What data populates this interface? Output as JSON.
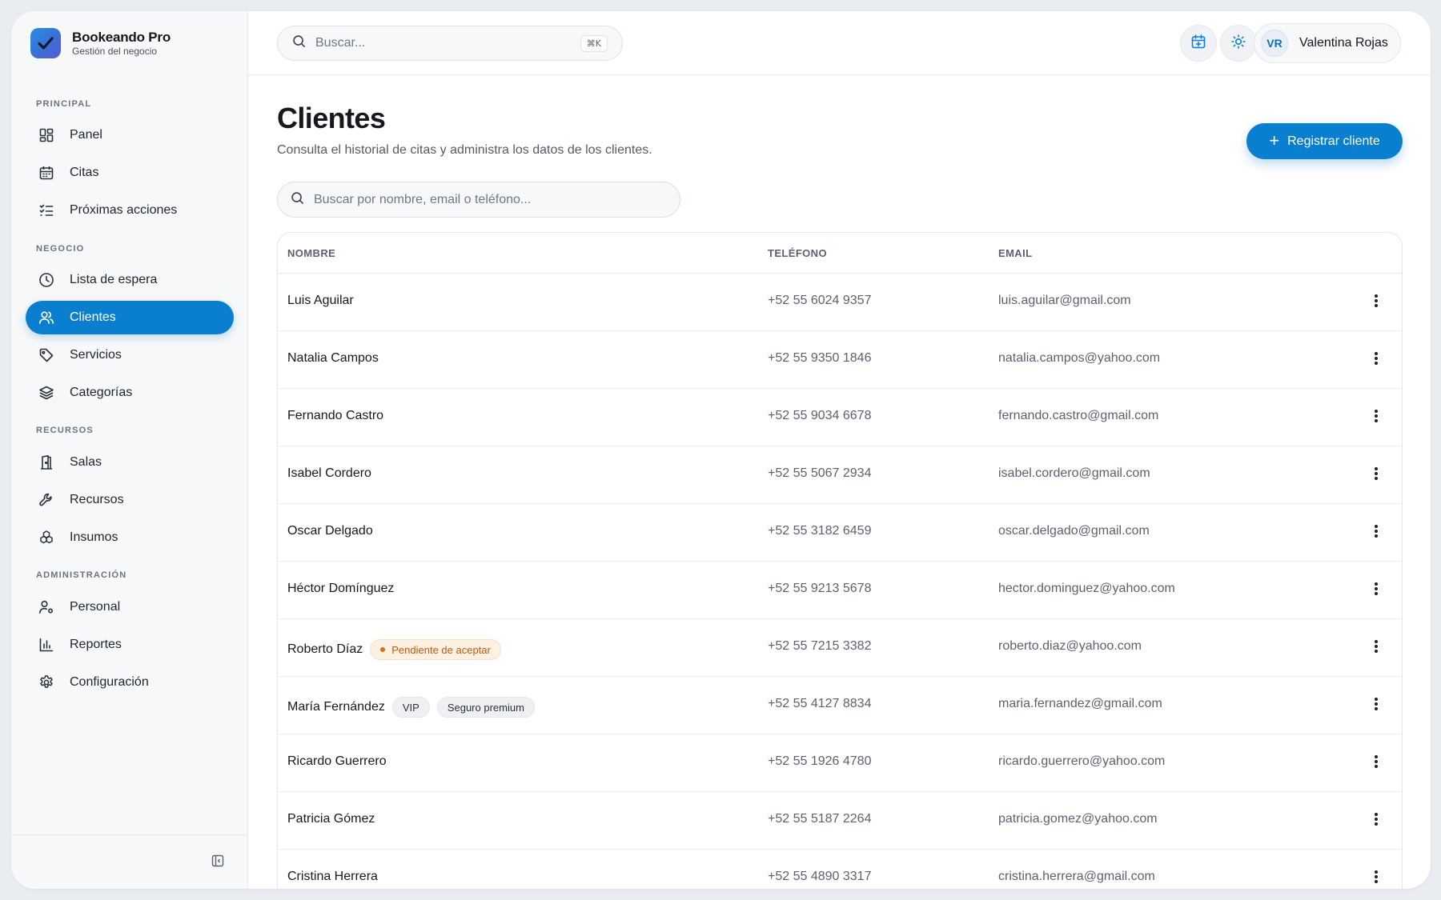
{
  "brand": {
    "name": "Bookeando Pro",
    "subtitle": "Gestión del negocio"
  },
  "sidebar": {
    "sections": [
      {
        "title": "PRINCIPAL",
        "items": [
          {
            "label": "Panel",
            "icon": "grid-icon"
          },
          {
            "label": "Citas",
            "icon": "calendar-icon"
          },
          {
            "label": "Próximas acciones",
            "icon": "checklist-icon"
          }
        ]
      },
      {
        "title": "NEGOCIO",
        "items": [
          {
            "label": "Lista de espera",
            "icon": "clock-icon"
          },
          {
            "label": "Clientes",
            "icon": "users-icon",
            "active": true
          },
          {
            "label": "Servicios",
            "icon": "tag-icon"
          },
          {
            "label": "Categorías",
            "icon": "layers-icon"
          }
        ]
      },
      {
        "title": "RECURSOS",
        "items": [
          {
            "label": "Salas",
            "icon": "door-icon"
          },
          {
            "label": "Recursos",
            "icon": "wrench-icon"
          },
          {
            "label": "Insumos",
            "icon": "boxes-icon"
          }
        ]
      },
      {
        "title": "ADMINISTRACIÓN",
        "items": [
          {
            "label": "Personal",
            "icon": "user-gear-icon"
          },
          {
            "label": "Reportes",
            "icon": "bar-chart-icon"
          },
          {
            "label": "Configuración",
            "icon": "gear-icon"
          }
        ]
      }
    ]
  },
  "topbar": {
    "search_placeholder": "Buscar...",
    "shortcut": "⌘K",
    "user": {
      "initials": "VR",
      "name": "Valentina Rojas"
    }
  },
  "page": {
    "title": "Clientes",
    "subtitle": "Consulta el historial de citas y administra los datos de los clientes.",
    "primary_button": "Registrar cliente",
    "search_placeholder": "Buscar por nombre, email o teléfono..."
  },
  "table": {
    "columns": [
      "NOMBRE",
      "TELÉFONO",
      "EMAIL"
    ],
    "rows": [
      {
        "name": "Luis Aguilar",
        "phone": "+52 55 6024 9357",
        "email": "luis.aguilar@gmail.com",
        "tags": []
      },
      {
        "name": "Natalia Campos",
        "phone": "+52 55 9350 1846",
        "email": "natalia.campos@yahoo.com",
        "tags": []
      },
      {
        "name": "Fernando Castro",
        "phone": "+52 55 9034 6678",
        "email": "fernando.castro@gmail.com",
        "tags": []
      },
      {
        "name": "Isabel Cordero",
        "phone": "+52 55 5067 2934",
        "email": "isabel.cordero@gmail.com",
        "tags": []
      },
      {
        "name": "Oscar Delgado",
        "phone": "+52 55 3182 6459",
        "email": "oscar.delgado@gmail.com",
        "tags": []
      },
      {
        "name": "Héctor Domínguez",
        "phone": "+52 55 9213 5678",
        "email": "hector.dominguez@yahoo.com",
        "tags": []
      },
      {
        "name": "Roberto Díaz",
        "phone": "+52 55 7215 3382",
        "email": "roberto.diaz@yahoo.com",
        "tags": [
          {
            "label": "Pendiente de aceptar",
            "kind": "warning"
          }
        ]
      },
      {
        "name": "María Fernández",
        "phone": "+52 55 4127 8834",
        "email": "maria.fernandez@gmail.com",
        "tags": [
          {
            "label": "VIP",
            "kind": "neutral"
          },
          {
            "label": "Seguro premium",
            "kind": "neutral"
          }
        ]
      },
      {
        "name": "Ricardo Guerrero",
        "phone": "+52 55 1926 4780",
        "email": "ricardo.guerrero@yahoo.com",
        "tags": []
      },
      {
        "name": "Patricia Gómez",
        "phone": "+52 55 5187 2264",
        "email": "patricia.gomez@yahoo.com",
        "tags": []
      },
      {
        "name": "Cristina Herrera",
        "phone": "+52 55 4890 3317",
        "email": "cristina.herrera@gmail.com",
        "tags": []
      }
    ]
  },
  "colors": {
    "accent": "#0a7fcf",
    "warning_text": "#c2570c",
    "warning_bg": "#fdf1e4"
  }
}
